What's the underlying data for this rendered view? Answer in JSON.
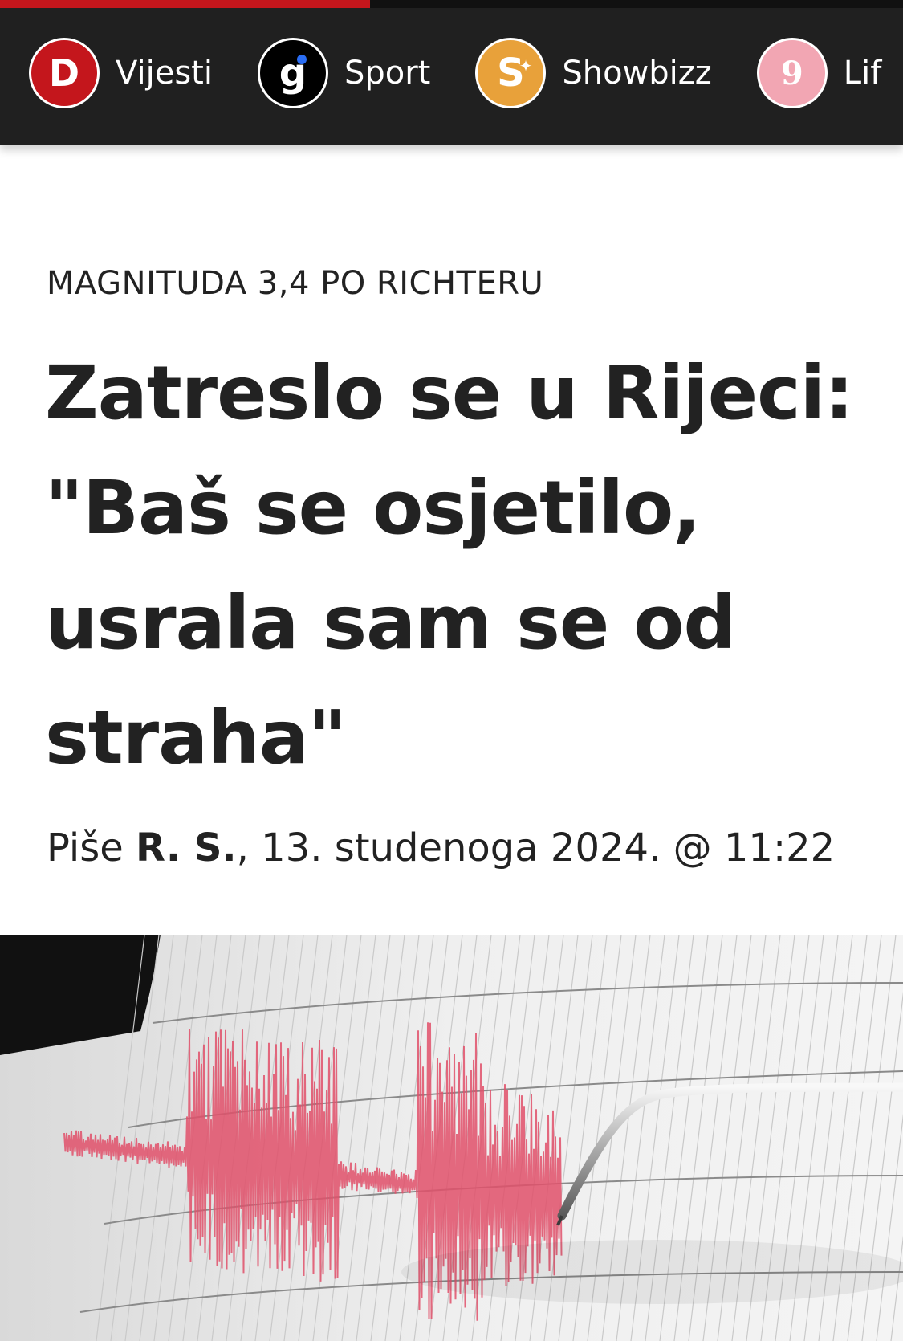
{
  "progress": {
    "fraction": 0.41,
    "color": "#c4161c"
  },
  "nav": {
    "items": [
      {
        "label": "Vijesti",
        "logo_letter": "D",
        "logo_color": "#c4161c",
        "icon": "dnevnik-logo-icon"
      },
      {
        "label": "Sport",
        "logo_letter": "g",
        "logo_color": "#000000",
        "icon": "gol-logo-icon"
      },
      {
        "label": "Showbizz",
        "logo_letter": "S",
        "logo_color": "#e8a13a",
        "icon": "showbizz-logo-icon"
      },
      {
        "label": "Lif",
        "logo_letter": "9",
        "logo_color": "#f2a6b3",
        "icon": "lifestyle-logo-icon"
      }
    ]
  },
  "article": {
    "kicker": "MAGNITUDA 3,4 PO RICHTERU",
    "headline_lines": [
      "Zatreslo se u Rijeci:",
      "\"Baš se osjetilo,",
      "usrala sam se od",
      "straha\""
    ],
    "byline": {
      "prefix": "Piše",
      "author": "R. S.",
      "date": ", 13. studenoga 2024. @ 11:22"
    },
    "image": {
      "subject": "seismograph-recording-icon"
    }
  }
}
